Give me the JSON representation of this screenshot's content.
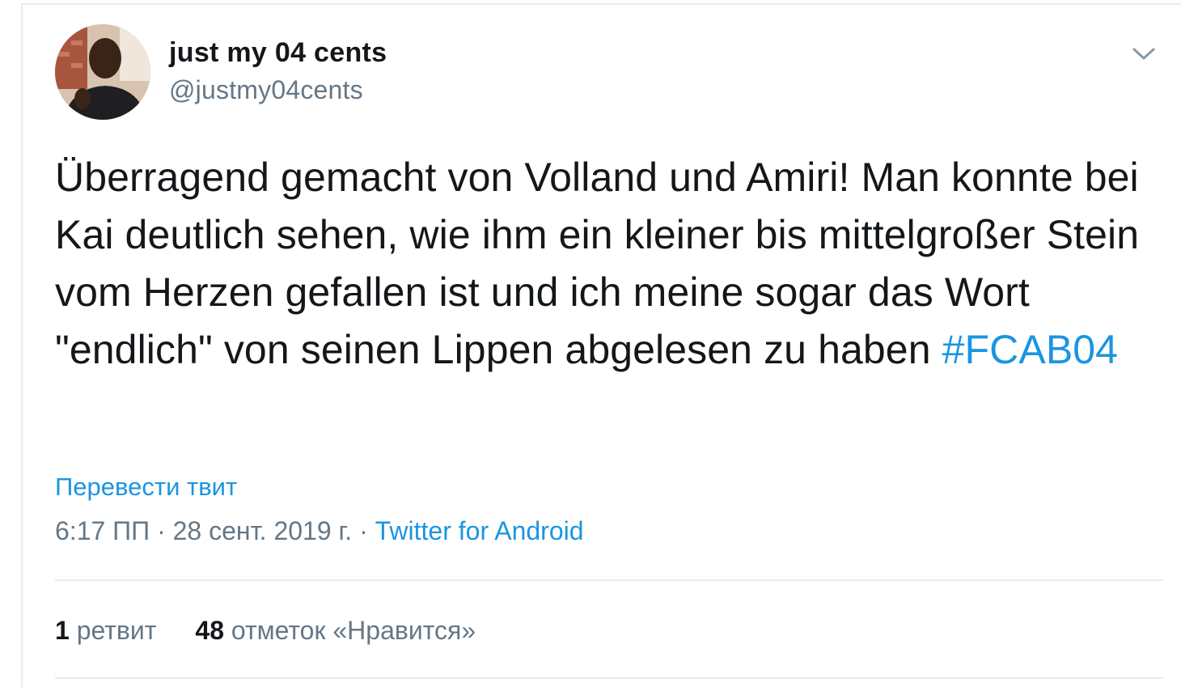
{
  "tweet": {
    "author": {
      "name": "just my 04 cents",
      "handle": "@justmy04cents"
    },
    "text": "Überragend gemacht von Volland und Amiri! Man konnte bei Kai deutlich sehen, wie ihm ein kleiner bis mittelgroßer Stein vom Herzen gefallen ist und ich meine sogar das Wort \"endlich\" von seinen Lippen abgelesen zu haben",
    "hashtag": "#FCAB04",
    "translate_label": "Перевести твит",
    "time": "6:17 ПП",
    "separator": "·",
    "date": "28 сент. 2019 г.",
    "source": "Twitter for Android",
    "stats": {
      "retweets_count": "1",
      "retweets_label": "ретвит",
      "likes_count": "48",
      "likes_label": "отметок «Нравится»"
    }
  },
  "colors": {
    "link": "#1b95e0",
    "text": "#14171a",
    "muted": "#657786",
    "border": "#e6ecf0"
  },
  "icons": {
    "menu": "chevron-down-icon"
  }
}
